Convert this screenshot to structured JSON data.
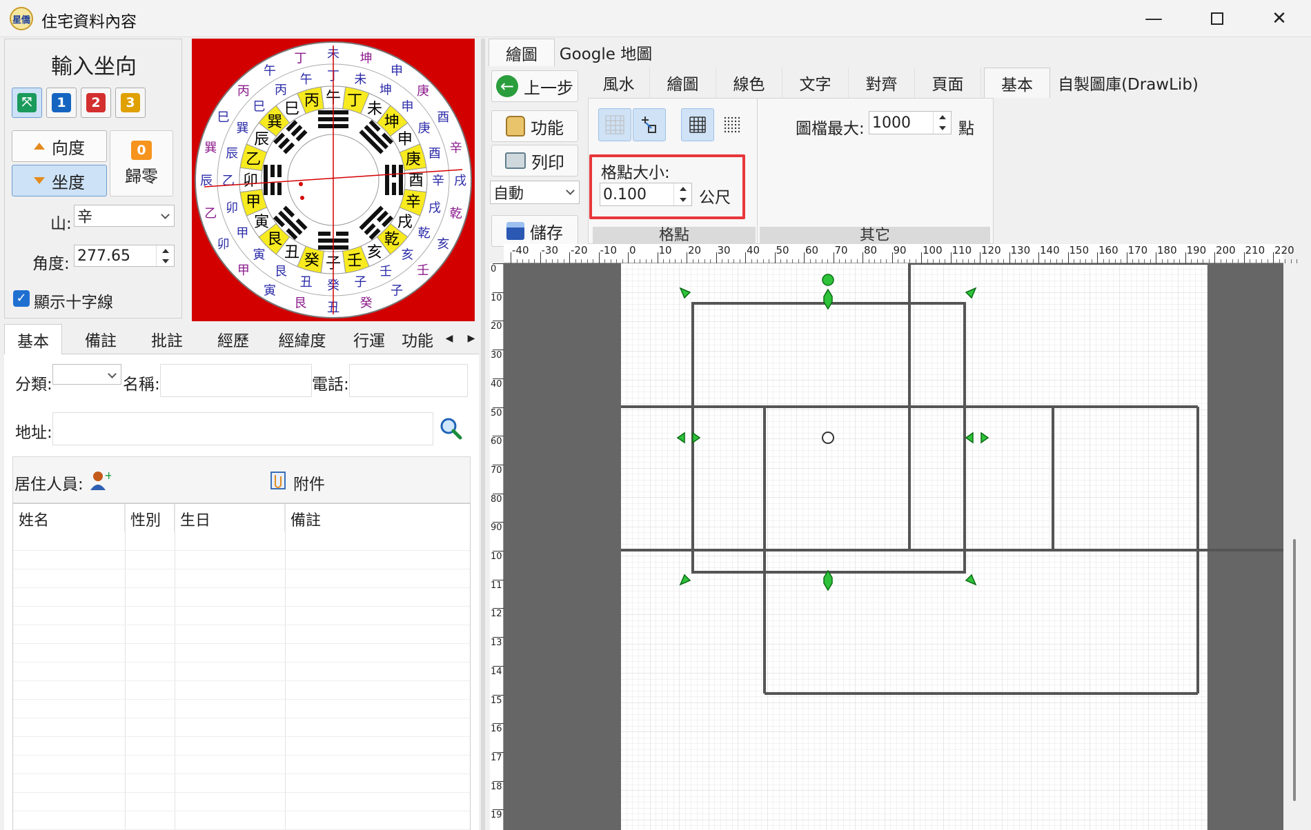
{
  "window": {
    "title": "住宅資料內容",
    "icon_text": "星僑"
  },
  "coord_panel": {
    "title": "輸入坐向",
    "num_buttons": [
      "1",
      "2",
      "3"
    ],
    "direction_btn": "向度",
    "sit_btn": "坐度",
    "zero_btn": "歸零",
    "zero_badge": "0",
    "mountain_label": "山:",
    "mountain_value": "辛",
    "angle_label": "角度:",
    "angle_value": "277.65",
    "crosshair_label": "顯示十字線",
    "crosshair_checked": true
  },
  "info_tabs": [
    "基本",
    "備註",
    "批註",
    "經歷",
    "經緯度",
    "行運",
    "功能"
  ],
  "info_form": {
    "category_label": "分類:",
    "name_label": "名稱:",
    "phone_label": "電話:",
    "address_label": "地址:",
    "residents_label": "居住人員:",
    "attachment_label": "附件",
    "columns": [
      "姓名",
      "性別",
      "生日",
      "備註"
    ]
  },
  "right_tabs": [
    "繪圖",
    "Google 地圖"
  ],
  "side_buttons": {
    "back": "上一步",
    "function": "功能",
    "print": "列印",
    "auto": "自動",
    "save": "儲存"
  },
  "ribbon_tabs": [
    "風水",
    "繪圖",
    "線色",
    "文字",
    "對齊",
    "頁面",
    "基本",
    "自製圖庫(DrawLib)"
  ],
  "ribbon": {
    "grid_size_label": "格點大小:",
    "grid_size_value": "0.100",
    "grid_unit": "公尺",
    "max_label": "圖檔最大:",
    "max_value": "1000",
    "max_unit": "點",
    "group_grid": "格點",
    "group_other": "其它"
  },
  "hruler_ticks": [
    "-40",
    "-30",
    "-20",
    "-10",
    "0",
    "10",
    "20",
    "30",
    "40",
    "50",
    "60",
    "70",
    "80",
    "90",
    "100",
    "110",
    "120",
    "130",
    "140",
    "150",
    "160",
    "170",
    "180",
    "190",
    "200",
    "210",
    "220"
  ],
  "vruler_ticks": [
    "0",
    "10",
    "20",
    "30",
    "40",
    "50",
    "60",
    "70",
    "80",
    "90",
    "10",
    "11",
    "12",
    "13",
    "14",
    "15",
    "16",
    "17",
    "18",
    "19"
  ],
  "compass": {
    "inner": [
      "子",
      "癸",
      "丑",
      "艮",
      "寅",
      "甲",
      "卯",
      "乙",
      "辰",
      "巽",
      "巳",
      "丙",
      "午",
      "丁",
      "未",
      "坤",
      "申",
      "庚",
      "酉",
      "辛",
      "戌",
      "乾",
      "亥",
      "壬"
    ],
    "outer": [
      "子",
      "癸",
      "丑",
      "艮",
      "寅",
      "甲",
      "卯",
      "乙",
      "辰",
      "巽",
      "巳",
      "丙",
      "午",
      "丁",
      "未",
      "坤",
      "申",
      "庚",
      "酉",
      "辛",
      "戌",
      "乾",
      "亥",
      "壬"
    ]
  },
  "colors": {
    "accent": "#1f6fd1",
    "selected": "#cde2f7",
    "highlight_box": "#e8363b",
    "compass_bg": "#d30000",
    "handle": "#2ec23a"
  }
}
